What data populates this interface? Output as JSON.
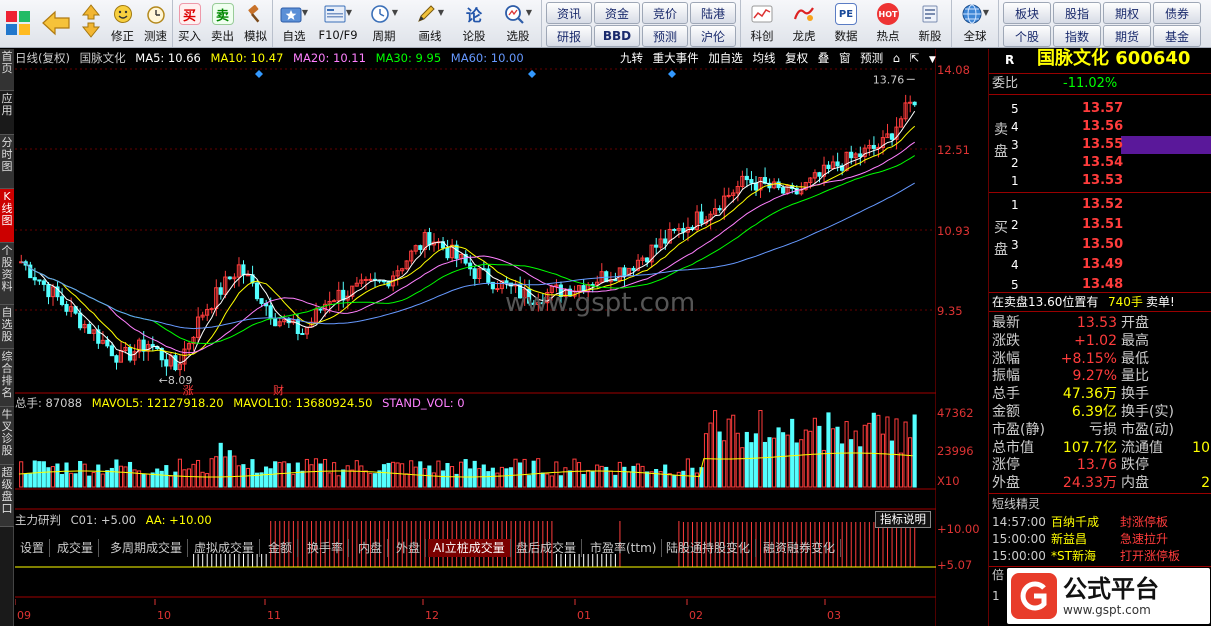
{
  "toolbar": {
    "group1": [
      {
        "label": "修正",
        "icon": "up-down-arrows-icon"
      },
      {
        "label": "测速",
        "icon": "stopwatch-icon"
      }
    ],
    "group2": [
      {
        "label": "买入",
        "icon": "buy-icon",
        "glyph": "买"
      },
      {
        "label": "卖出",
        "icon": "sell-icon",
        "glyph": "卖"
      },
      {
        "label": "模拟",
        "icon": "gavel-icon"
      }
    ],
    "group3": [
      {
        "label": "自选",
        "icon": "star-folder-icon"
      },
      {
        "label": "F10/F9",
        "icon": "f10-icon"
      },
      {
        "label": "周期",
        "icon": "clock-icon"
      },
      {
        "label": "画线",
        "icon": "pencil-icon"
      },
      {
        "label": "论股",
        "icon": "discuss-icon",
        "glyph": "论"
      },
      {
        "label": "选股",
        "icon": "magnifier-chart-icon"
      }
    ],
    "quick_buttons": [
      "资讯",
      "资金",
      "竞价",
      "陆港",
      "研报",
      "BBD",
      "预测",
      "沪伦"
    ],
    "group4": [
      {
        "label": "科创",
        "icon": "kechuang-icon"
      },
      {
        "label": "龙虎",
        "icon": "dragon-tiger-icon"
      },
      {
        "label": "数据",
        "icon": "pe-data-icon",
        "glyph": "PE"
      },
      {
        "label": "热点",
        "icon": "hot-icon",
        "glyph": "HOT"
      },
      {
        "label": "新股",
        "icon": "ipo-icon"
      }
    ],
    "globe_label": "全球",
    "right_buttons": [
      "板块",
      "股指",
      "期权",
      "债券",
      "个股",
      "指数",
      "期货",
      "基金"
    ]
  },
  "left_tabs": [
    "首页",
    "应用",
    "分时图",
    "K线图",
    "个股资料",
    "自选股",
    "综合排名",
    "牛叉诊股",
    "超级盘口"
  ],
  "chart_header": {
    "period": "日线(复权)",
    "stock_name": "国脉文化",
    "ma5": "MA5: 10.66",
    "ma10": "MA10: 10.47",
    "ma20": "MA20: 10.11",
    "ma30": "MA30: 9.95",
    "ma60": "MA60: 10.00",
    "right_tools": [
      "九转",
      "重大事件",
      "加自选",
      "均线",
      "复权",
      "叠",
      "窗",
      "预测"
    ]
  },
  "price_axis": [
    "14.08",
    "12.51",
    "10.93",
    "9.35"
  ],
  "price_annotations": {
    "high": "13.76",
    "low": "8.09",
    "marker1": "涨",
    "marker2": "财"
  },
  "watermark": "www.gspt.com",
  "volume_header": {
    "total": "总手: 87088",
    "mavol5": "MAVOL5: 12127918.20",
    "mavol10": "MAVOL10: 13680924.50",
    "stand": "STAND_VOL: 0"
  },
  "volume_axis": [
    "47362",
    "23996",
    "X10"
  ],
  "bottom_tabs": [
    "设置",
    "成交量",
    "多周期成交量",
    "虚拟成交量",
    "金额",
    "换手率",
    "内盘",
    "外盘",
    "AI立桩成交量",
    "盘后成交量",
    "市盈率(ttm)",
    "陆股通持股变化",
    "融资融券变化"
  ],
  "indicator": {
    "name": "主力研判",
    "c01": "C01: +5.00",
    "aa": "AA: +10.00",
    "button": "指标说明",
    "axis": [
      "+10.00",
      "+5.07"
    ]
  },
  "x_axis_months": [
    "09",
    "10",
    "11",
    "12",
    "01",
    "02",
    "03"
  ],
  "right_panel": {
    "r_label": "R",
    "stock_title": "国脉文化 600640",
    "weibi_label": "委比",
    "weibi": "-11.02%",
    "sell_label": "卖盘",
    "buy_label": "买盘",
    "asks": [
      {
        "lvl": "5",
        "price": "13.57"
      },
      {
        "lvl": "4",
        "price": "13.56"
      },
      {
        "lvl": "3",
        "price": "13.55"
      },
      {
        "lvl": "2",
        "price": "13.54"
      },
      {
        "lvl": "1",
        "price": "13.53"
      }
    ],
    "bids": [
      {
        "lvl": "1",
        "price": "13.52"
      },
      {
        "lvl": "2",
        "price": "13.51"
      },
      {
        "lvl": "3",
        "price": "13.50"
      },
      {
        "lvl": "4",
        "price": "13.49"
      },
      {
        "lvl": "5",
        "price": "13.48"
      }
    ],
    "note": "在卖盘13.60位置有",
    "note_vol": "740手",
    "note_tag": "卖单!",
    "stats": [
      {
        "k1": "最新",
        "v1": "13.53",
        "k2": "开盘",
        "v2": ""
      },
      {
        "k1": "涨跌",
        "v1": "+1.02",
        "k2": "最高",
        "v2": ""
      },
      {
        "k1": "涨幅",
        "v1": "+8.15%",
        "k2": "最低",
        "v2": ""
      },
      {
        "k1": "振幅",
        "v1": "9.27%",
        "k2": "量比",
        "v2": ""
      },
      {
        "k1": "总手",
        "v1": "47.36万",
        "k2": "换手",
        "v2": ""
      },
      {
        "k1": "金额",
        "v1": "6.39亿",
        "k2": "换手(实)",
        "v2": ""
      },
      {
        "k1": "市盈(静)",
        "v1": "亏损",
        "k2": "市盈(动)",
        "v2": ""
      },
      {
        "k1": "总市值",
        "v1": "107.7亿",
        "k2": "流通值",
        "v2": "10"
      },
      {
        "k1": "涨停",
        "v1": "13.76",
        "k2": "跌停",
        "v2": ""
      },
      {
        "k1": "外盘",
        "v1": "24.33万",
        "k2": "内盘",
        "v2": "2"
      }
    ],
    "sprite_title": "短线精灵",
    "sprites": [
      {
        "time": "14:57:00",
        "name": "百纳千成",
        "event": "封涨停板"
      },
      {
        "time": "15:00:00",
        "name": "新益昌",
        "event": "急速拉升"
      },
      {
        "time": "15:00:00",
        "name": "*ST新海",
        "event": "打开涨停板"
      }
    ],
    "footer_char1": "倍",
    "footer_char2": "1"
  },
  "brand": {
    "name": "公式平台",
    "url": "www.gspt.com"
  },
  "colors": {
    "up": "#ff3c3c",
    "down": "#54ffff",
    "ma5": "#ffffff",
    "ma10": "#ffff00",
    "ma20": "#ff80ff",
    "ma30": "#00ff00",
    "ma60": "#6699ff",
    "accent_red": "#ff0000",
    "axis": "#a00000"
  }
}
